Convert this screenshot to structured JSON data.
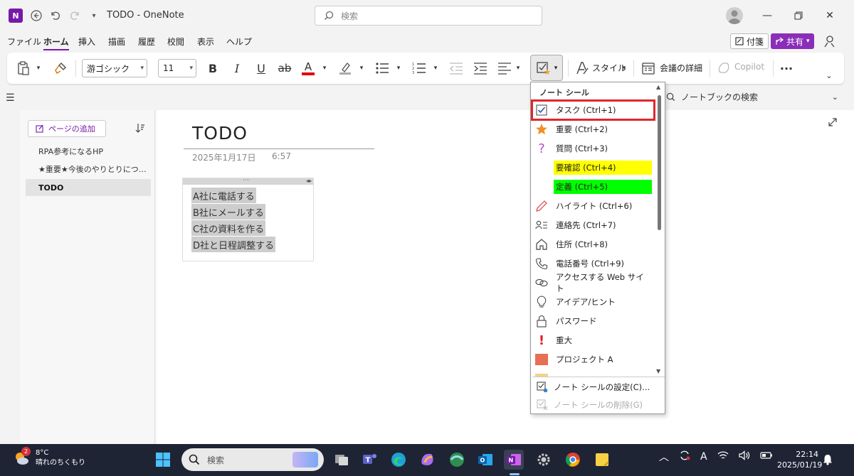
{
  "titlebar": {
    "logo_letter": "N",
    "doc_title": "TODO - OneNote",
    "search_placeholder": "検索"
  },
  "menubar": {
    "items": [
      "ファイル",
      "ホーム",
      "挿入",
      "描画",
      "履歴",
      "校閲",
      "表示",
      "ヘルプ"
    ],
    "active": "ホーム",
    "fusen_label": "付箋",
    "share_label": "共有"
  },
  "ribbon": {
    "font_name": "游ゴシック",
    "font_size": "11",
    "bold": "B",
    "italic": "I",
    "underline": "U",
    "strike": "ab",
    "font_color": "A",
    "style_label": "スタイル",
    "meeting_label": "会議の詳細",
    "copilot_label": "Copilot",
    "more": "···"
  },
  "notebook_search": "ノートブックの検索",
  "page_panel": {
    "add_page_label": "ページの追加",
    "pages": [
      {
        "title": "RPA参考になるHP",
        "selected": false
      },
      {
        "title": "★重要★今後のやりとりにつ…",
        "selected": false
      },
      {
        "title": "TODO",
        "selected": true
      }
    ]
  },
  "page": {
    "title": "TODO",
    "date": "2025年1月17日",
    "time": "6:57",
    "outline_handle": "····",
    "tasks": [
      "A社に電話する",
      "B社にメールする",
      "C社の資料を作る",
      "D社と日程調整する"
    ]
  },
  "tag_menu": {
    "header": "ノート シール",
    "items": [
      {
        "label": "タスク (Ctrl+1)",
        "icon": "checkbox-icon",
        "highlighted": true
      },
      {
        "label": "重要 (Ctrl+2)",
        "icon": "star-icon"
      },
      {
        "label": "質問 (Ctrl+3)",
        "icon": "question-icon"
      },
      {
        "label": "要確認 (Ctrl+4)",
        "icon": "none",
        "bg": "#ffff00"
      },
      {
        "label": "定義 (Ctrl+5)",
        "icon": "none",
        "bg": "#00ff00"
      },
      {
        "label": "ハイライト (Ctrl+6)",
        "icon": "pencil-icon"
      },
      {
        "label": "連絡先 (Ctrl+7)",
        "icon": "contact-icon"
      },
      {
        "label": "住所 (Ctrl+8)",
        "icon": "house-icon"
      },
      {
        "label": "電話番号 (Ctrl+9)",
        "icon": "phone-icon"
      },
      {
        "label": "アクセスする Web サイト",
        "icon": "link-icon"
      },
      {
        "label": "アイデア/ヒント",
        "icon": "lightbulb-icon"
      },
      {
        "label": "パスワード",
        "icon": "lock-icon"
      },
      {
        "label": "重大",
        "icon": "exclamation-icon"
      },
      {
        "label": "プロジェクト A",
        "icon": "red-square-icon"
      }
    ],
    "footer": [
      {
        "label": "ノート シールの設定(C)...",
        "enabled": true
      },
      {
        "label": "ノート シールの削除(G)",
        "enabled": false
      }
    ],
    "scroll_up": "▲",
    "scroll_down": "▼"
  },
  "taskbar": {
    "weather_temp": "8°C",
    "weather_desc": "晴れのちくもり",
    "weather_badge": "2",
    "search_placeholder": "検索",
    "tray_a": "A",
    "time": "22:14",
    "date": "2025/01/19"
  },
  "colors": {
    "onenote_purple": "#7719aa",
    "highlight_red": "#e0262d",
    "taskbar_bg": "#1e2434"
  }
}
